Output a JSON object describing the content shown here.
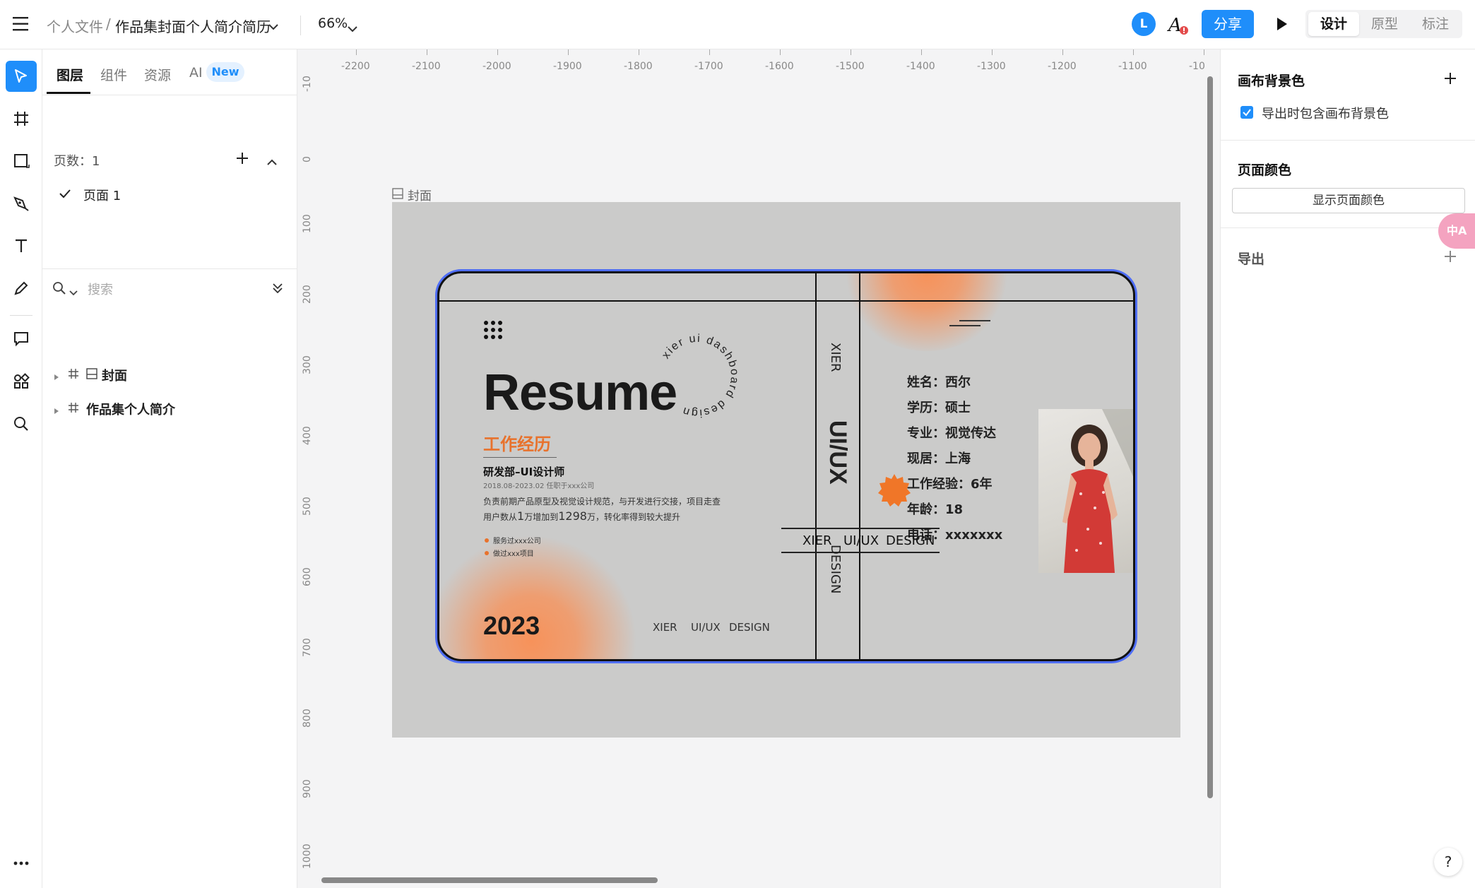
{
  "topbar": {
    "breadcrumb_parent": "个人文件",
    "breadcrumb_sep": "/",
    "file_name": "作品集封面个人简介简历",
    "zoom": "66%",
    "avatar_letter": "L",
    "share_label": "分享",
    "modes": [
      "设计",
      "原型",
      "标注"
    ],
    "active_mode": "设计"
  },
  "layers_panel": {
    "tabs": [
      "图层",
      "组件",
      "资源",
      "AI"
    ],
    "new_badge": "New",
    "pages_label": "页数：1",
    "pages": [
      "页面 1"
    ],
    "search_placeholder": "搜索",
    "layers": [
      "封面",
      "作品集个人简介"
    ]
  },
  "canvas": {
    "ruler_x": [
      "-2200",
      "-2100",
      "-2000",
      "-1900",
      "-1800",
      "-1700",
      "-1600",
      "-1500",
      "-1400",
      "-1300",
      "-1200",
      "-1100",
      "-10"
    ],
    "ruler_y": [
      "-10",
      "0",
      "100",
      "200",
      "300",
      "400",
      "500",
      "600",
      "700",
      "800",
      "900",
      "1000"
    ],
    "frame_label": "封面"
  },
  "design": {
    "resume_title": "Resume",
    "circle_text": "xier ui dashboard design",
    "section_title": "工作经历",
    "job_title": "研发部–UI设计师",
    "job_period": "2018.08-2023.02   任职于xxx公司",
    "desc_line1": "负责前期产品原型及视觉设计规范，与开发进行交接，项目走查",
    "desc_line2_a": "用户数从",
    "desc_line2_b": "1",
    "desc_line2_c": "万增加到",
    "desc_line2_d": "1298",
    "desc_line2_e": "万，转化率得到较大提升",
    "bullet1": "服务过xxx公司",
    "bullet2": "做过xxx项目",
    "year": "2023",
    "footer_left": [
      "XIER",
      "UI/UX",
      "DESIGN"
    ],
    "spine": [
      "XIER",
      "UI/UX",
      "DESIGN"
    ],
    "info": [
      "姓名：西尔",
      "学历：硕士",
      "专业：视觉传达",
      "现居：上海",
      "工作经验：6年",
      "年龄：18",
      "电话：xxxxxxx"
    ],
    "footer_right": [
      "XIER",
      "UI/UX",
      "DESIGN"
    ],
    "accent": "#f7925a",
    "title_accent": "#e8722c"
  },
  "right_panel": {
    "canvas_bg_title": "画布背景色",
    "include_bg_label": "导出时包含画布背景色",
    "page_color_title": "页面颜色",
    "show_page_color": "显示页面颜色",
    "export_title": "导出",
    "help": "?",
    "translate_badge": "中A"
  }
}
